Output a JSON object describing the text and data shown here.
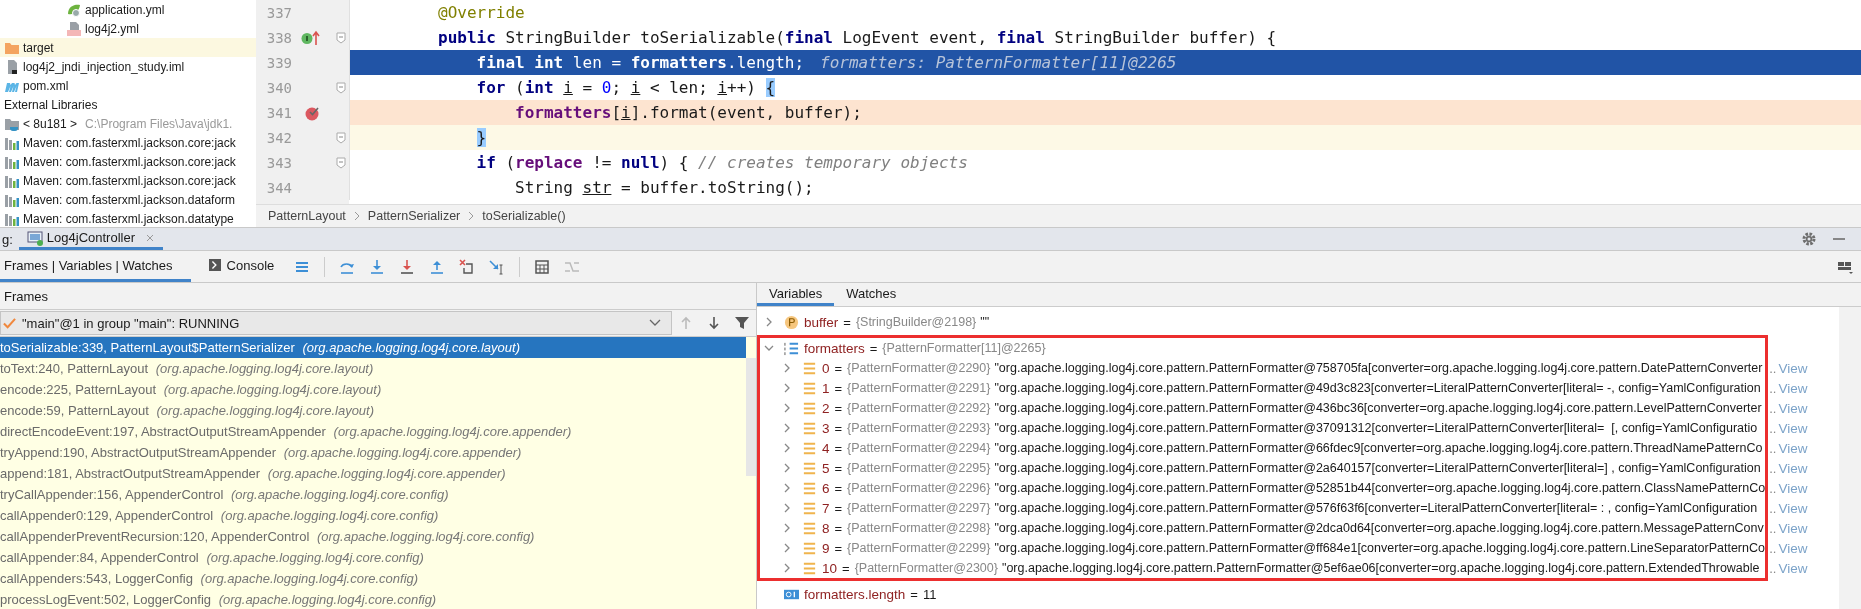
{
  "project_tree": {
    "partial_branch": [
      {
        "label": "application.yml",
        "kind": "spring"
      },
      {
        "label": "log4j2.yml",
        "kind": "yml"
      }
    ],
    "items": [
      {
        "label": "target",
        "kind": "folder",
        "highlighted": true
      },
      {
        "label": "log4j2_jndi_injection_study.iml",
        "kind": "iml",
        "highlighted": false
      },
      {
        "label": "pom.xml",
        "kind": "maven",
        "highlighted": false
      },
      {
        "label": "External Libraries",
        "kind": "libraries",
        "highlighted": false,
        "children": [
          {
            "label": "< 8u181 >",
            "path": "C:\\Program Files\\Java\\jdk1.",
            "kind": "jdk",
            "highlighted": false
          },
          {
            "label": "Maven: com.fasterxml.jackson.core:jack",
            "kind": "lib",
            "highlighted": false
          },
          {
            "label": "Maven: com.fasterxml.jackson.core:jack",
            "kind": "lib",
            "highlighted": false
          },
          {
            "label": "Maven: com.fasterxml.jackson.core:jack",
            "kind": "lib",
            "highlighted": false
          },
          {
            "label": "Maven: com.fasterxml.jackson.dataform",
            "kind": "lib",
            "highlighted": false
          },
          {
            "label": "Maven: com.fasterxml.jackson.datatype",
            "kind": "lib",
            "highlighted": false
          }
        ]
      }
    ]
  },
  "editor": {
    "lines": [
      {
        "number": "337",
        "execution": false,
        "breakpoint": false,
        "caret": false,
        "override": false,
        "fold": false,
        "tokens": [
          {
            "text": "@Override",
            "kind": "annotation"
          }
        ]
      },
      {
        "number": "338",
        "execution": false,
        "breakpoint": false,
        "caret": false,
        "override": true,
        "fold": true,
        "tokens": [
          {
            "text": "public",
            "kind": "kw"
          },
          {
            "text": " StringBuilder toSerializable(",
            "kind": "plain"
          },
          {
            "text": "final",
            "kind": "kw"
          },
          {
            "text": " LogEvent event, ",
            "kind": "plain"
          },
          {
            "text": "final",
            "kind": "kw"
          },
          {
            "text": " StringBuilder buffer) {",
            "kind": "plain"
          }
        ]
      },
      {
        "number": "339",
        "execution": true,
        "breakpoint": false,
        "caret": false,
        "override": false,
        "fold": false,
        "tokens": [
          {
            "text": "    final",
            "kind": "kw"
          },
          {
            "text": " int",
            "kind": "kw"
          },
          {
            "text": " len = ",
            "kind": "plain"
          },
          {
            "text": "formatters",
            "kind": "field"
          },
          {
            "text": ".length;",
            "kind": "plain"
          },
          {
            "text": "formatters: PatternFormatter[11]@2265",
            "kind": "hint"
          }
        ]
      },
      {
        "number": "340",
        "execution": false,
        "breakpoint": false,
        "caret": false,
        "override": false,
        "fold": true,
        "tokens": [
          {
            "text": "    for",
            "kind": "kw"
          },
          {
            "text": " (",
            "kind": "plain"
          },
          {
            "text": "int ",
            "kind": "kw"
          },
          {
            "text": "i",
            "kind": "local"
          },
          {
            "text": " = ",
            "kind": "plain"
          },
          {
            "text": "0",
            "kind": "num"
          },
          {
            "text": "; ",
            "kind": "plain"
          },
          {
            "text": "i",
            "kind": "local"
          },
          {
            "text": " < len; ",
            "kind": "plain"
          },
          {
            "text": "i",
            "kind": "local"
          },
          {
            "text": "++) ",
            "kind": "plain"
          },
          {
            "text": "{",
            "kind": "brace"
          }
        ]
      },
      {
        "number": "341",
        "execution": false,
        "breakpoint": true,
        "caret": false,
        "override": false,
        "fold": false,
        "tokens": [
          {
            "text": "        formatters",
            "kind": "field"
          },
          {
            "text": "[",
            "kind": "plain"
          },
          {
            "text": "i",
            "kind": "local"
          },
          {
            "text": "].format(event, buffer);",
            "kind": "plain"
          }
        ]
      },
      {
        "number": "342",
        "execution": false,
        "breakpoint": false,
        "caret": true,
        "override": false,
        "fold": true,
        "tokens": [
          {
            "text": "    }",
            "kind": "brace"
          }
        ]
      },
      {
        "number": "343",
        "execution": false,
        "breakpoint": false,
        "caret": false,
        "override": false,
        "fold": true,
        "tokens": [
          {
            "text": "    if",
            "kind": "kw"
          },
          {
            "text": " (",
            "kind": "plain"
          },
          {
            "text": "replace",
            "kind": "field"
          },
          {
            "text": " != ",
            "kind": "plain"
          },
          {
            "text": "null",
            "kind": "kw"
          },
          {
            "text": ") { ",
            "kind": "plain"
          },
          {
            "text": "// creates temporary objects",
            "kind": "comment"
          }
        ]
      },
      {
        "number": "344",
        "execution": false,
        "breakpoint": false,
        "caret": false,
        "override": false,
        "fold": false,
        "tokens": [
          {
            "text": "        String ",
            "kind": "plain"
          },
          {
            "text": "str",
            "kind": "local"
          },
          {
            "text": " = buffer.toString();",
            "kind": "plain"
          }
        ]
      }
    ],
    "breadcrumbs": [
      "PatternLayout",
      "PatternSerializer",
      "toSerializable()"
    ]
  },
  "debug": {
    "label": "g:",
    "tabs": [
      {
        "label": "Log4jController",
        "selected": true
      }
    ],
    "toolbar_tabs": [
      {
        "label": "Frames | Variables | Watches",
        "selected": true,
        "kind": "plain"
      },
      {
        "label": "Console",
        "selected": false,
        "kind": "console"
      }
    ]
  },
  "frames": {
    "title": "Frames",
    "thread": "\"main\"@1 in group \"main\": RUNNING",
    "rows": [
      {
        "method": "toSerializable:339, PatternLayout$PatternSerializer",
        "package": "(org.apache.logging.log4j.core.layout)",
        "selected": true
      },
      {
        "method": "toText:240, PatternLayout",
        "package": "(org.apache.logging.log4j.core.layout)",
        "selected": false
      },
      {
        "method": "encode:225, PatternLayout",
        "package": "(org.apache.logging.log4j.core.layout)",
        "selected": false
      },
      {
        "method": "encode:59, PatternLayout",
        "package": "(org.apache.logging.log4j.core.layout)",
        "selected": false
      },
      {
        "method": "directEncodeEvent:197, AbstractOutputStreamAppender",
        "package": "(org.apache.logging.log4j.core.appender)",
        "selected": false
      },
      {
        "method": "tryAppend:190, AbstractOutputStreamAppender",
        "package": "(org.apache.logging.log4j.core.appender)",
        "selected": false
      },
      {
        "method": "append:181, AbstractOutputStreamAppender",
        "package": "(org.apache.logging.log4j.core.appender)",
        "selected": false
      },
      {
        "method": "tryCallAppender:156, AppenderControl",
        "package": "(org.apache.logging.log4j.core.config)",
        "selected": false
      },
      {
        "method": "callAppender0:129, AppenderControl",
        "package": "(org.apache.logging.log4j.core.config)",
        "selected": false
      },
      {
        "method": "callAppenderPreventRecursion:120, AppenderControl",
        "package": "(org.apache.logging.log4j.core.config)",
        "selected": false
      },
      {
        "method": "callAppender:84, AppenderControl",
        "package": "(org.apache.logging.log4j.core.config)",
        "selected": false
      },
      {
        "method": "callAppenders:543, LoggerConfig",
        "package": "(org.apache.logging.log4j.core.config)",
        "selected": false
      },
      {
        "method": "processLogEvent:502, LoggerConfig",
        "package": "(org.apache.logging.log4j.core.config)",
        "selected": false
      }
    ]
  },
  "variables": {
    "tabs": [
      {
        "label": "Variables",
        "selected": true
      },
      {
        "label": "Watches",
        "selected": false
      }
    ],
    "items": [
      {
        "kind": "param",
        "name": "buffer",
        "eq": "=",
        "ref": "{StringBuilder@2198}",
        "value": "\"\"",
        "expanded": false,
        "annotated": false
      },
      {
        "kind": "array",
        "name": "formatters",
        "eq": "=",
        "ref": "{PatternFormatter[11]@2265}",
        "expanded": true,
        "annotated": true,
        "children": [
          {
            "name": "0",
            "eq": "=",
            "ref": "{PatternFormatter@2290}",
            "value": "\"org.apache.logging.log4j.core.pattern.PatternFormatter@758705fa[converter=org.apache.logging.log4j.core.pattern.DatePatternConverter",
            "more": "..",
            "view": "View"
          },
          {
            "name": "1",
            "eq": "=",
            "ref": "{PatternFormatter@2291}",
            "value": "\"org.apache.logging.log4j.core.pattern.PatternFormatter@49d3c823[converter=LiteralPatternConverter[literal= -, config=YamlConfiguration",
            "more": "..",
            "view": "View"
          },
          {
            "name": "2",
            "eq": "=",
            "ref": "{PatternFormatter@2292}",
            "value": "\"org.apache.logging.log4j.core.pattern.PatternFormatter@436bc36[converter=org.apache.logging.log4j.core.pattern.LevelPatternConverter",
            "more": "..",
            "view": "View"
          },
          {
            "name": "3",
            "eq": "=",
            "ref": "{PatternFormatter@2293}",
            "value": "\"org.apache.logging.log4j.core.pattern.PatternFormatter@37091312[converter=LiteralPatternConverter[literal=  [, config=YamlConfiguratio",
            "more": "..",
            "view": "View"
          },
          {
            "name": "4",
            "eq": "=",
            "ref": "{PatternFormatter@2294}",
            "value": "\"org.apache.logging.log4j.core.pattern.PatternFormatter@66fdec9[converter=org.apache.logging.log4j.core.pattern.ThreadNamePatternCo",
            "more": "..",
            "view": "View"
          },
          {
            "name": "5",
            "eq": "=",
            "ref": "{PatternFormatter@2295}",
            "value": "\"org.apache.logging.log4j.core.pattern.PatternFormatter@2a640157[converter=LiteralPatternConverter[literal=] , config=YamlConfiguration",
            "more": "..",
            "view": "View"
          },
          {
            "name": "6",
            "eq": "=",
            "ref": "{PatternFormatter@2296}",
            "value": "\"org.apache.logging.log4j.core.pattern.PatternFormatter@52851b44[converter=org.apache.logging.log4j.core.pattern.ClassNamePatternCo",
            "more": "..",
            "view": "View"
          },
          {
            "name": "7",
            "eq": "=",
            "ref": "{PatternFormatter@2297}",
            "value": "\"org.apache.logging.log4j.core.pattern.PatternFormatter@576f63f6[converter=LiteralPatternConverter[literal= : , config=YamlConfiguration",
            "more": "..",
            "view": "View"
          },
          {
            "name": "8",
            "eq": "=",
            "ref": "{PatternFormatter@2298}",
            "value": "\"org.apache.logging.log4j.core.pattern.PatternFormatter@2dca0d64[converter=org.apache.logging.log4j.core.pattern.MessagePatternConv",
            "more": "..",
            "view": "View"
          },
          {
            "name": "9",
            "eq": "=",
            "ref": "{PatternFormatter@2299}",
            "value": "\"org.apache.logging.log4j.core.pattern.PatternFormatter@ff684e1[converter=org.apache.logging.log4j.core.pattern.LineSeparatorPatternCo",
            "more": "..",
            "view": "View"
          },
          {
            "name": "10",
            "eq": "=",
            "ref": "{PatternFormatter@2300}",
            "value": "\"org.apache.logging.log4j.core.pattern.PatternFormatter@5ef6ae06[converter=org.apache.logging.log4j.core.pattern.ExtendedThrowable",
            "more": "..",
            "view": "View"
          }
        ]
      },
      {
        "kind": "int",
        "name": "formatters.length",
        "eq": "=",
        "value": "11",
        "annotated": false
      }
    ]
  }
}
